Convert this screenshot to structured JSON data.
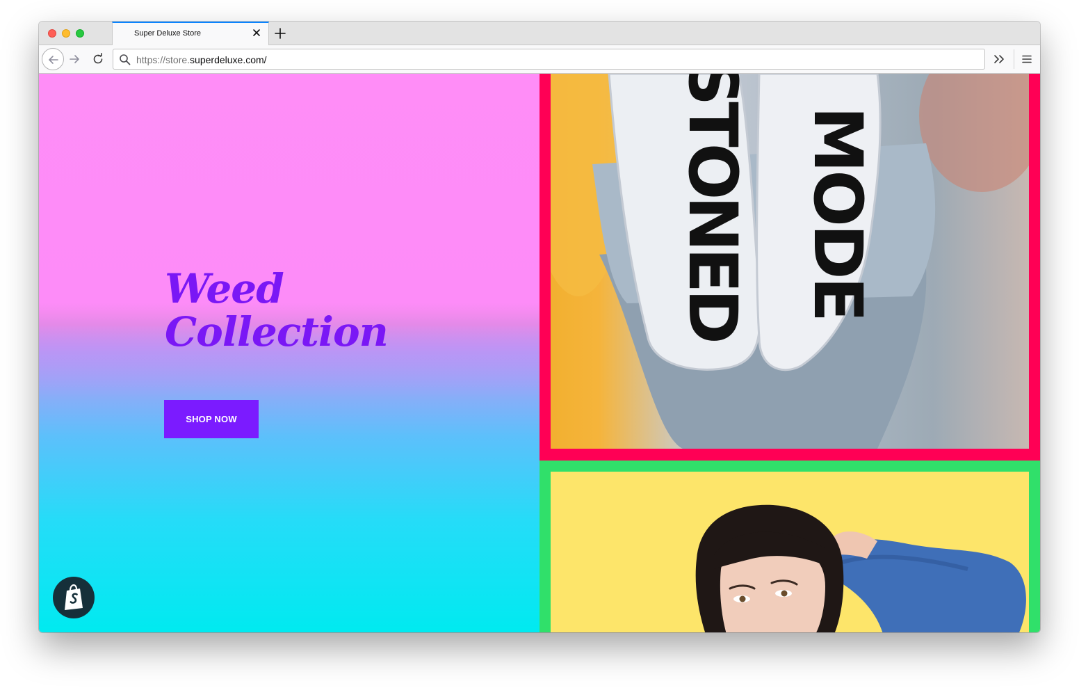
{
  "browser": {
    "tab": {
      "title": "Super Deluxe Store"
    },
    "address_bar": {
      "scheme": "https://store.",
      "host": "superdeluxe.com/"
    },
    "accent_color": "#0a84ff"
  },
  "page": {
    "hero": {
      "title_line1": "Weed",
      "title_line2": "Collection",
      "button_label": "SHOP NOW",
      "title_color": "#7a17f5",
      "button_color": "#7b1bff"
    },
    "panels": {
      "top": {
        "frame_color": "#ff0055",
        "sock_left_text": "STONED",
        "sock_right_text": "MODE"
      },
      "bottom": {
        "frame_color": "#30e06a",
        "background_color": "#fde56a"
      }
    },
    "icons": [
      "back-arrow-icon",
      "forward-arrow-icon",
      "reload-icon",
      "search-icon",
      "close-icon",
      "plus-icon",
      "overflow-chevrons-icon",
      "hamburger-menu-icon",
      "shopify-bag-icon"
    ]
  }
}
